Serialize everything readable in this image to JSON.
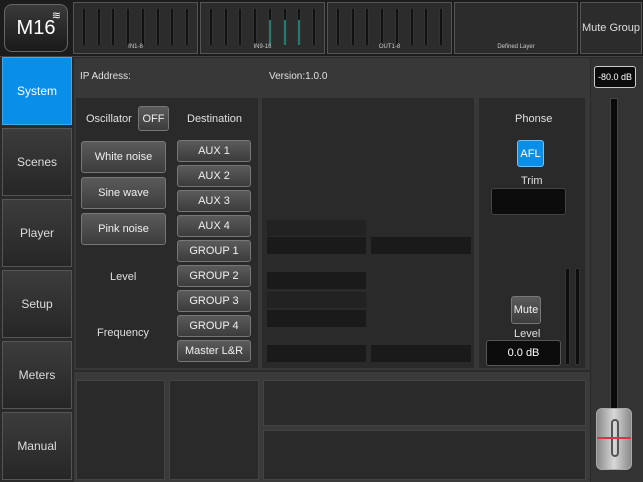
{
  "header": {
    "logo": "M16",
    "meter_groups": [
      {
        "label": "IN1-8"
      },
      {
        "label": "IN9-16"
      },
      {
        "label": "OUT1-8"
      },
      {
        "label": "Defined Layer"
      }
    ],
    "mute_group": "Mute Group"
  },
  "nav": {
    "items": [
      {
        "label": "System",
        "active": true
      },
      {
        "label": "Scenes"
      },
      {
        "label": "Player"
      },
      {
        "label": "Setup"
      },
      {
        "label": "Meters"
      },
      {
        "label": "Manual"
      }
    ]
  },
  "system": {
    "ip_label": "IP Address:",
    "version": "Version:1.0.0"
  },
  "oscillator": {
    "label": "Oscillator",
    "toggle": "OFF",
    "destination_label": "Destination",
    "noise_buttons": [
      "White noise",
      "Sine wave",
      "Pink noise"
    ],
    "level_label": "Level",
    "frequency_label": "Frequency",
    "destinations": [
      "AUX 1",
      "AUX 2",
      "AUX 3",
      "AUX 4",
      "GROUP 1",
      "GROUP 2",
      "GROUP 3",
      "GROUP 4",
      "Master L&R"
    ]
  },
  "phone": {
    "title": "Phonse",
    "afl": "AFL",
    "trim_label": "Trim",
    "mute": "Mute",
    "level_label": "Level",
    "level_value": "0.0 dB"
  },
  "fader": {
    "db": "-80.0 dB"
  },
  "colors": {
    "accent": "#0a8fe8",
    "meter_lit": "#1e7c70",
    "fader_line": "#e0304a"
  }
}
